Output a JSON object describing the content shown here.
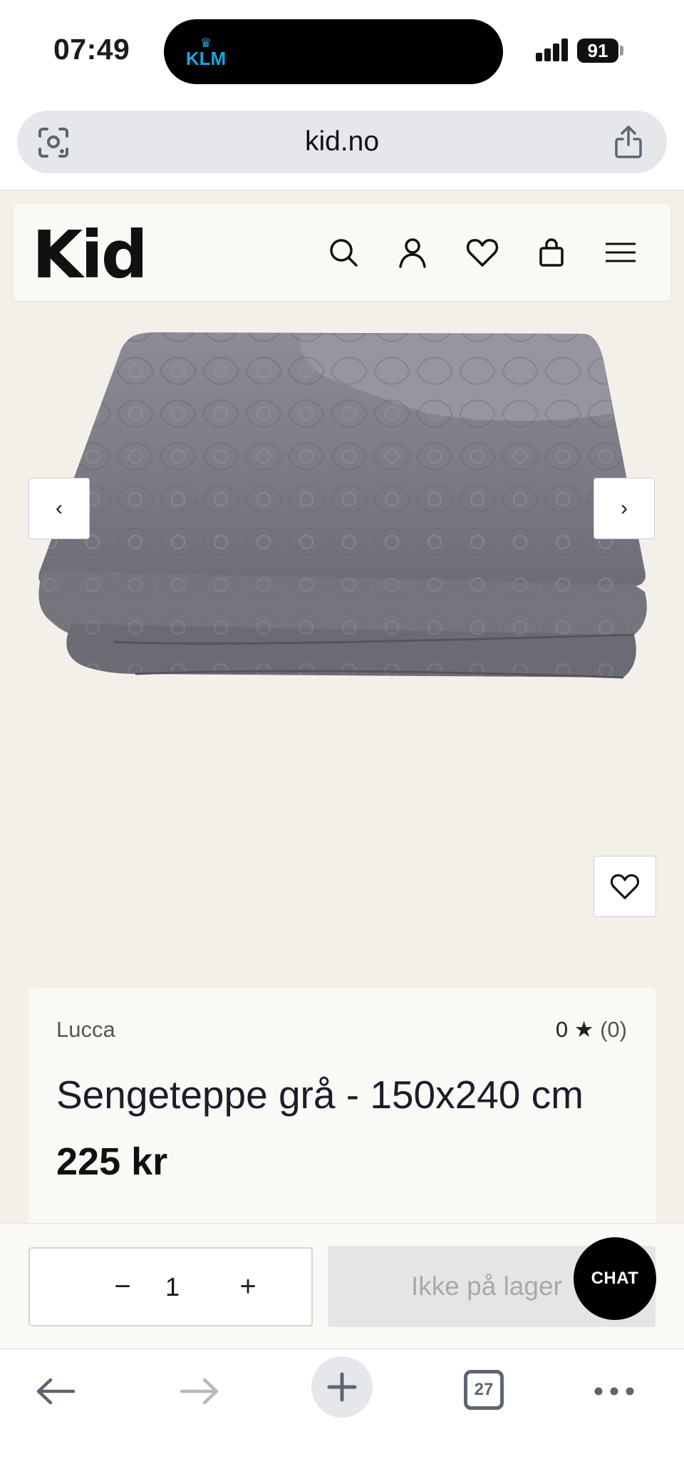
{
  "status_bar": {
    "time": "07:49",
    "island_app": "KLM",
    "battery": "91"
  },
  "browser": {
    "url": "kid.no",
    "tabs_count": "27"
  },
  "site": {
    "logo": "Kid"
  },
  "gallery": {
    "prev_label": "‹",
    "next_label": "›"
  },
  "product": {
    "brand": "Lucca",
    "rating_value": "0",
    "rating_star": "★",
    "rating_count": "(0)",
    "title": "Sengeteppe grå - 150x240 cm",
    "price": "225 kr"
  },
  "cart": {
    "quantity": "1",
    "minus": "−",
    "plus": "+",
    "status_label": "Ikke på lager"
  },
  "chat": {
    "label": "CHAT"
  },
  "colors": {
    "background": "#f3f0ea",
    "card": "#faf9f5",
    "blanket": "#7f7e86"
  }
}
